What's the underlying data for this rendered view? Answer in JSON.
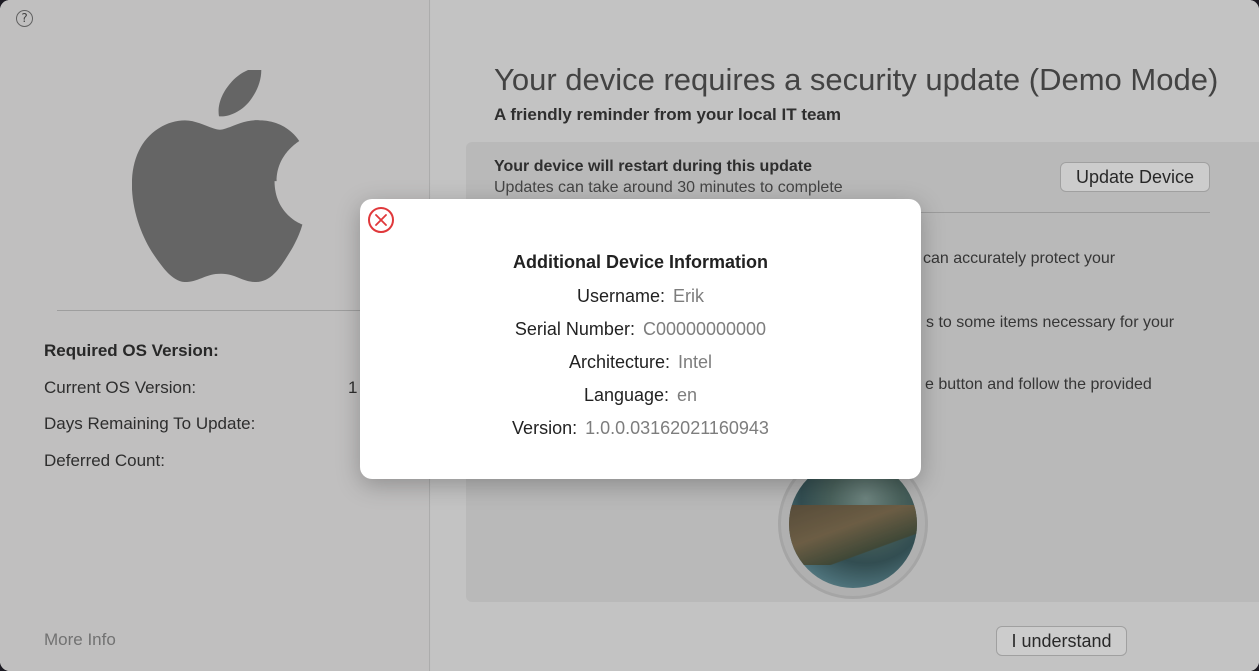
{
  "sidebar": {
    "help_icon": "?",
    "required_os_label": "Required OS Version:",
    "current_os_label": "Current OS Version:",
    "current_os_value_partial": "1",
    "days_remaining_label": "Days Remaining To Update:",
    "deferred_count_label": "Deferred Count:",
    "more_info": "More Info"
  },
  "main": {
    "title": "Your device requires a security update (Demo Mode)",
    "subtitle": "A friendly reminder from your local IT team",
    "card": {
      "heading": "Your device will restart during this update",
      "subheading": "Updates can take around 30 minutes to complete",
      "update_button": "Update Device",
      "line1_partial": "can accurately protect your",
      "line2_partial": "s to some items necessary for your",
      "line3_partial": "e button and follow the provided"
    },
    "understand_button": "I understand"
  },
  "modal": {
    "title": "Additional Device Information",
    "rows": [
      {
        "label": "Username:",
        "value": "Erik"
      },
      {
        "label": "Serial Number:",
        "value": "C00000000000"
      },
      {
        "label": "Architecture:",
        "value": "Intel"
      },
      {
        "label": "Language:",
        "value": "en"
      },
      {
        "label": "Version:",
        "value": "1.0.0.03162021160943"
      }
    ]
  },
  "colors": {
    "close_accent": "#e0383b",
    "logo_gray": "#7f7f7f"
  },
  "icons": {
    "help": "help-icon",
    "logo": "apple-logo-icon",
    "close": "close-circle-icon"
  }
}
